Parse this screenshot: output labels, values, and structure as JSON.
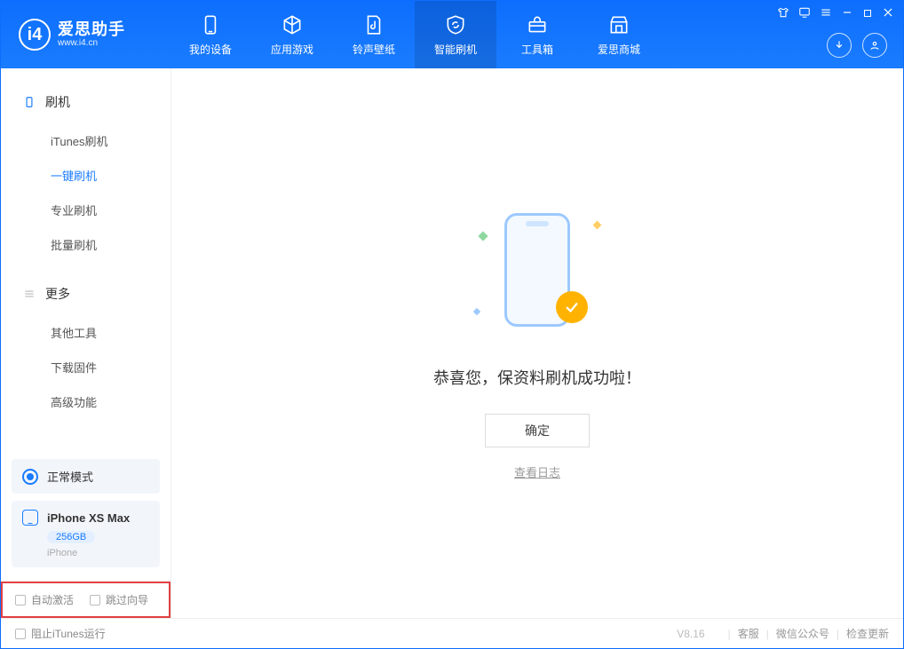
{
  "app": {
    "name_cn": "爱思助手",
    "url": "www.i4.cn",
    "logo_letter": "i4"
  },
  "nav": {
    "items": [
      {
        "label": "我的设备"
      },
      {
        "label": "应用游戏"
      },
      {
        "label": "铃声壁纸"
      },
      {
        "label": "智能刷机"
      },
      {
        "label": "工具箱"
      },
      {
        "label": "爱思商城"
      }
    ],
    "active_index": 3
  },
  "sidebar": {
    "sections": [
      {
        "title": "刷机",
        "items": [
          "iTunes刷机",
          "一键刷机",
          "专业刷机",
          "批量刷机"
        ],
        "active_index": 1
      },
      {
        "title": "更多",
        "items": [
          "其他工具",
          "下载固件",
          "高级功能"
        ],
        "active_index": -1
      }
    ],
    "mode": {
      "label": "正常模式"
    },
    "device": {
      "name": "iPhone XS Max",
      "storage": "256GB",
      "subtitle": "iPhone"
    },
    "options": {
      "auto_activate": "自动激活",
      "skip_guide": "跳过向导"
    }
  },
  "main": {
    "success_message": "恭喜您，保资料刷机成功啦！",
    "ok_button": "确定",
    "view_log": "查看日志"
  },
  "statusbar": {
    "block_itunes": "阻止iTunes运行",
    "version": "V8.16",
    "links": [
      "客服",
      "微信公众号",
      "检查更新"
    ]
  }
}
